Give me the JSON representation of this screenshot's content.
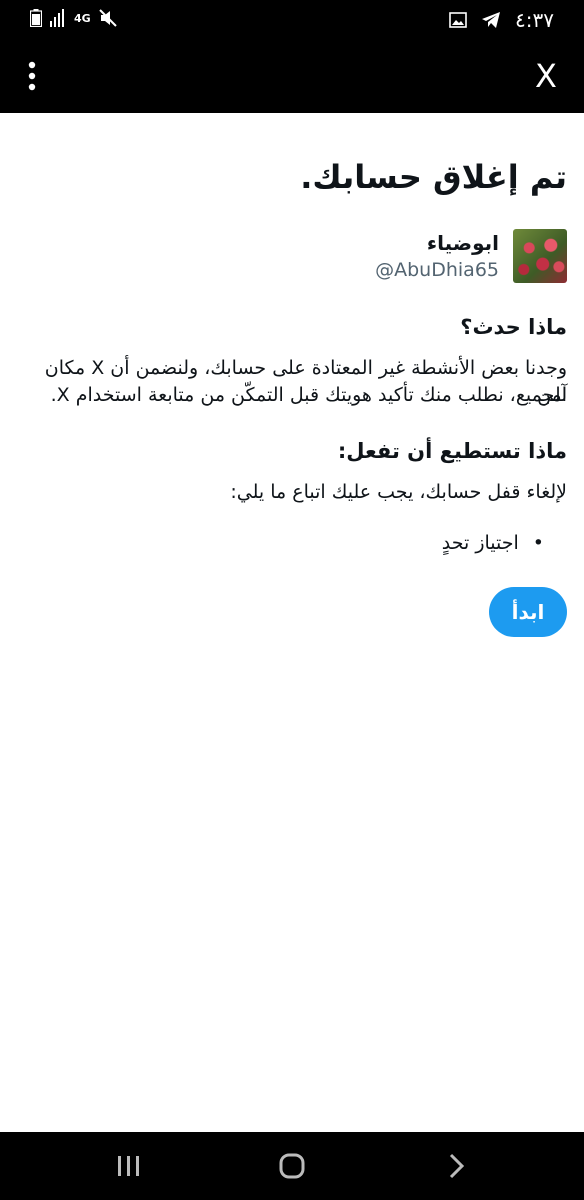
{
  "status_bar": {
    "time": "٤:٣٧",
    "network": "4G"
  },
  "app_bar": {
    "close_label": "X"
  },
  "page": {
    "title": "تم إغلاق حسابك.",
    "profile": {
      "display_name": "ابوضياء",
      "handle": "@AbuDhia65"
    },
    "what_happened": {
      "heading": "ماذا حدث؟",
      "line1": "وجدنا بعض الأنشطة غير المعتادة على حسابك، ولنضمن أن X مكان آمن",
      "line2": "للجميع، نطلب منك تأكيد هويتك قبل التمكّن من متابعة استخدام X."
    },
    "what_to_do": {
      "heading": "ماذا تستطيع أن تفعل:",
      "text": "لإلغاء قفل حسابك، يجب عليك اتباع ما يلي:",
      "steps": [
        "اجتياز تحدٍ"
      ]
    },
    "start_button": "ابدأ"
  },
  "colors": {
    "accent": "#1d9bf0",
    "secondary_text": "#536471",
    "bars": "#000000"
  }
}
